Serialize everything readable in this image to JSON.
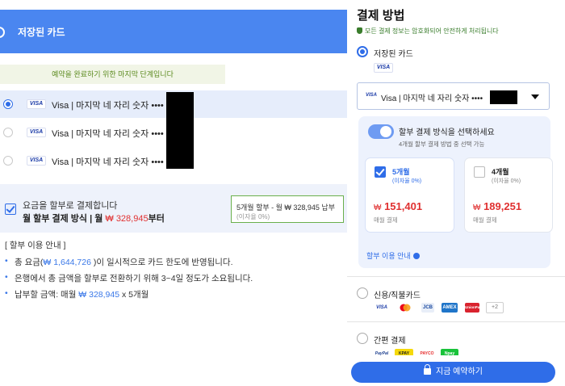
{
  "left_page": {
    "header_title": "저장된 카드",
    "banner_text": "예약을 완료하기 위한 마지막 단계입니다",
    "cards": [
      {
        "brand": "VISA",
        "label": "Visa | 마지막 네 자리 숫자 ••••",
        "selected": true
      },
      {
        "brand": "VISA",
        "label": "Visa | 마지막 네 자리 숫자 ••••",
        "selected": false
      },
      {
        "brand": "VISA",
        "label": "Visa | 마지막 네 자리 숫자 ••••",
        "selected": false
      }
    ],
    "installment": {
      "line1": "요금을 할부로 결제합니다",
      "line2_prefix": "월 할부 결제 방식 | 월 ",
      "line2_amount": "₩ 328,945",
      "line2_suffix": "부터",
      "box_line1": "5개월 할부 - 월 ₩ 328,945 납부",
      "box_line2": "(이자율 0%)"
    },
    "guide": {
      "title": "[ 할부 이용 안내 ]",
      "item1_a": "총 요금(",
      "item1_amount": "₩ 1,644,726",
      "item1_b": " )이 일시적으로 카드 한도에 반영됩니다.",
      "item2": "은행에서 총 금액을 할부로 전환하기 위해 3~4일 정도가 소요됩니다.",
      "item3_a": "납부할 금액: 매월 ",
      "item3_amount": "₩ 328,945",
      "item3_b": " x 5개월"
    }
  },
  "panel": {
    "title": "결제 방법",
    "secure_note": "모든 결제 정보는 암호화되어 안전하게 처리됩니다",
    "saved_cards_label": "저장된 카드",
    "saved_badge": "VISA",
    "card_select": {
      "brand": "VISA",
      "text": "Visa | 마지막 네 자리 숫자 ••••"
    },
    "installment": {
      "toggle_on": true,
      "title": "할부 결제 방식을 선택하세요",
      "subtitle": "4개월 할부 결제 방법 중 선택 가능",
      "options": [
        {
          "months": "5개월",
          "rate": "(이자율 0%)",
          "currency": "₩",
          "price": "151,401",
          "period": "매월 결제",
          "selected": true
        },
        {
          "months": "4개월",
          "rate": "(이자율 0%)",
          "currency": "₩",
          "price": "189,251",
          "period": "매월 결제",
          "selected": false
        }
      ],
      "guide_link": "할부 이용 안내"
    },
    "credit_card": {
      "label": "신용/직불카드",
      "logos": [
        "VISA",
        "MC",
        "JCB",
        "AMEX",
        "UnionPay",
        "+2"
      ]
    },
    "easy_pay": {
      "label": "간편 결제",
      "logos": [
        "PayPal",
        "KPAY",
        "PAYCO",
        "Npay"
      ]
    }
  },
  "pay_button": "지금 예약하기",
  "colors": {
    "accent": "#2f6de8",
    "header_blue": "#4a86f0",
    "price_red": "#e03030",
    "secure_green": "#3a7d2c"
  }
}
